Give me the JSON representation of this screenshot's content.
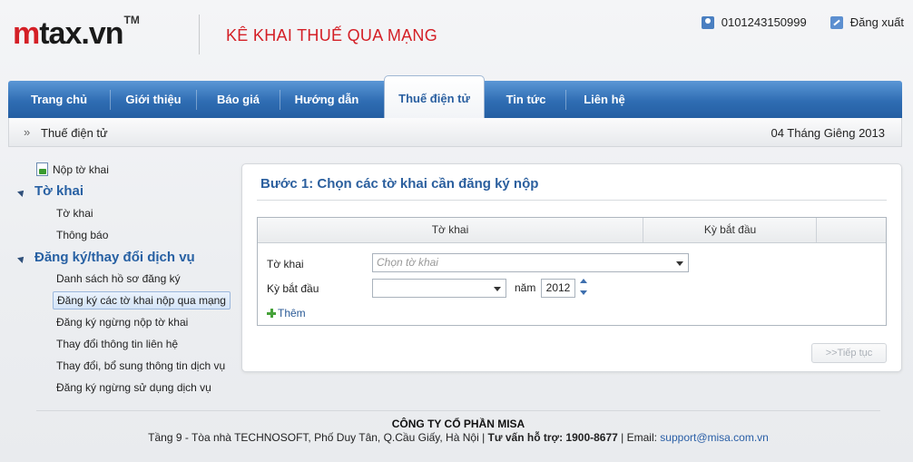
{
  "header": {
    "logo_m": "m",
    "logo_rest": "tax.vn",
    "logo_tm": "TM",
    "tagline": "KÊ KHAI THUẾ QUA MẠNG",
    "user_code": "0101243150999",
    "logout_label": "Đăng xuất"
  },
  "nav": {
    "items": [
      {
        "label": "Trang chủ"
      },
      {
        "label": "Giới thiệu"
      },
      {
        "label": "Báo giá"
      },
      {
        "label": "Hướng dẫn"
      },
      {
        "label": "Thuế điện tử"
      },
      {
        "label": "Tin tức"
      },
      {
        "label": "Liên hệ"
      }
    ],
    "active": "Thuế điện tử"
  },
  "breadcrumb": {
    "arrows": "»",
    "text": "Thuế điện tử",
    "date": "04 Tháng Giêng 2013"
  },
  "sidebar": {
    "top_link": "Nộp tờ khai",
    "sections": [
      {
        "heading": "Tờ khai",
        "items": [
          "Tờ khai",
          "Thông báo"
        ]
      },
      {
        "heading": "Đăng ký/thay đổi dịch vụ",
        "items": [
          "Danh sách hồ sơ đăng ký",
          "Đăng ký các tờ khai nộp qua mạng",
          "Đăng ký ngừng nộp tờ khai",
          "Thay đổi thông tin liên hệ",
          "Thay đổi, bổ sung thông tin dịch vụ",
          "Đăng ký ngừng sử dụng dịch vụ"
        ]
      }
    ],
    "selected": "Đăng ký các tờ khai nộp qua mạng"
  },
  "main": {
    "step_title": "Bước 1: Chọn các tờ khai cần đăng ký nộp",
    "grid_headers": [
      "Tờ khai",
      "Kỳ bắt đầu"
    ],
    "form": {
      "tokhai_label": "Tờ khai",
      "tokhai_placeholder": "Chọn tờ khai",
      "kybatdau_label": "Kỳ bắt đầu",
      "kybatdau_value": "",
      "year_label": "năm",
      "year_value": "2012"
    },
    "add_label": "Thêm",
    "next_label": ">>Tiếp tục"
  },
  "footer": {
    "company": "CÔNG TY CỔ PHẦN MISA",
    "address": "Tầng 9 - Tòa nhà TECHNOSOFT, Phố Duy Tân, Q.Cầu Giấy, Hà Nội",
    "hotline_label": "Tư vấn hỗ trợ: 1900-8677",
    "email_label": "Email:",
    "email": "support@misa.com.vn"
  },
  "colors": {
    "brand_red": "#d41f26",
    "nav_blue": "#2f6db3",
    "title_blue": "#2b5f9e"
  }
}
